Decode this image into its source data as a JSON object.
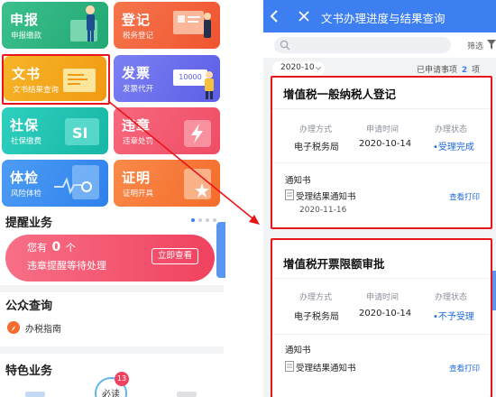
{
  "left": {
    "tiles": [
      {
        "title": "申报",
        "sub": "申报缴款"
      },
      {
        "title": "登记",
        "sub": "税务登记"
      },
      {
        "title": "文书",
        "sub": "文书结果查询"
      },
      {
        "title": "发票",
        "sub": "发票代开",
        "deco_text": "10000"
      },
      {
        "title": "社保",
        "sub": "社保缴费"
      },
      {
        "title": "违章",
        "sub": "违章处罚"
      },
      {
        "title": "体检",
        "sub": "风险体检"
      },
      {
        "title": "证明",
        "sub": "证明开具"
      }
    ],
    "reminder": {
      "section_title": "提醒业务",
      "text_prefix": "您有",
      "count": "0",
      "text_suffix": "个",
      "line2": "违章提醒等待处理",
      "button": "立即查看"
    },
    "public_query": {
      "section_title": "公众查询",
      "item": "办税指南"
    },
    "special": {
      "section_title": "特色业务",
      "must_read": "必读",
      "badge": "13"
    }
  },
  "right": {
    "header": {
      "title": "文书办理进度与结果查询",
      "filter": "筛选"
    },
    "filterbar": {
      "date": "2020-10",
      "applied_prefix": "已申请事项",
      "applied_count": "2",
      "applied_suffix": "项"
    },
    "cards": [
      {
        "title": "增值税一般纳税人登记",
        "col_labels": [
          "办理方式",
          "申请时间",
          "办理状态"
        ],
        "method": "电子税务局",
        "date": "2020-10-14",
        "status": "•受理完成",
        "notice_label": "通知书",
        "doc_name": "受理结果通知书",
        "doc_date": "2020-11-16",
        "action": "查看打印"
      },
      {
        "title": "增值税开票限额审批",
        "col_labels": [
          "办理方式",
          "申请时间",
          "办理状态"
        ],
        "method": "电子税务局",
        "date": "2020-10-14",
        "status": "•不予受理",
        "notice_label": "通知书",
        "doc_name": "受理结果通知书",
        "action": "查看打印"
      }
    ]
  },
  "colors": {
    "header_blue": "#3d7ff0",
    "highlight_red": "#e8151b",
    "link_blue": "#1f6bd9"
  }
}
